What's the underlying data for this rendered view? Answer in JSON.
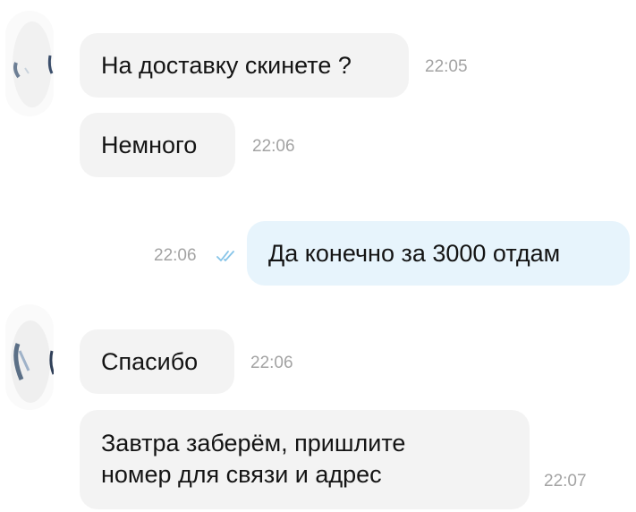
{
  "colors": {
    "incoming_bubble": "#f3f3f3",
    "outgoing_bubble": "#e7f4fc",
    "message_text": "#141414",
    "timestamp": "#a3a3a3",
    "read_ticks": "#86c4e8"
  },
  "messages": [
    {
      "direction": "incoming",
      "text": "На доставку скинете ?",
      "time": "22:05"
    },
    {
      "direction": "incoming",
      "text": "Немного",
      "time": "22:06"
    },
    {
      "direction": "outgoing",
      "text": "Да конечно за 3000 отдам",
      "time": "22:06",
      "status_icon": "double-check-icon"
    },
    {
      "direction": "incoming",
      "text": "Спасибо",
      "time": "22:06"
    },
    {
      "direction": "incoming",
      "text_lines": [
        "Завтра заберём, пришлите",
        "номер для связи и адрес"
      ],
      "time": "22:07"
    }
  ]
}
